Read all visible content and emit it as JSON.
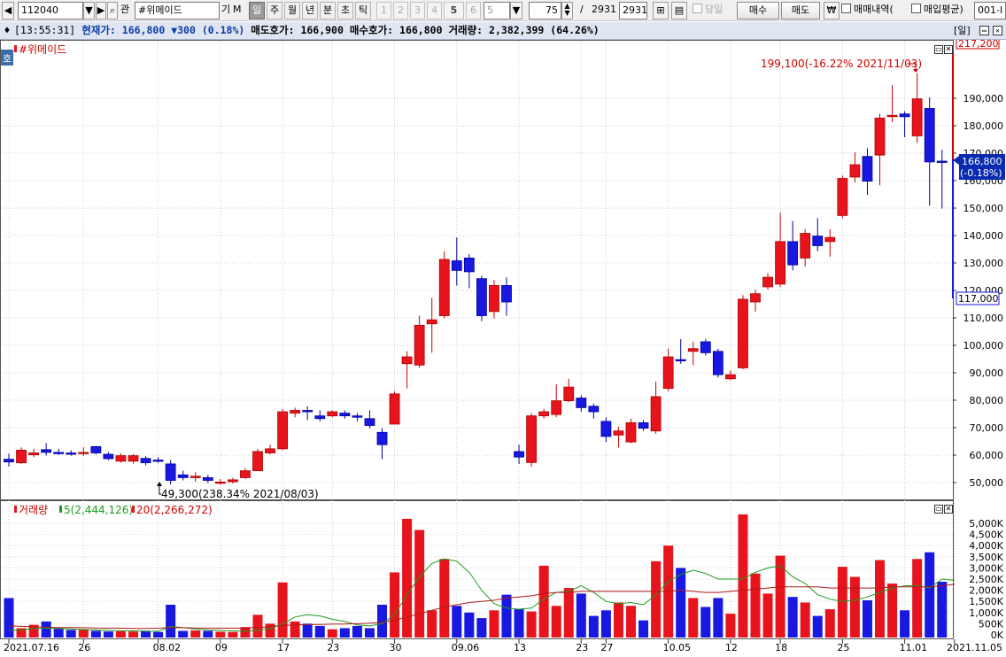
{
  "toolbar": {
    "stock_code": "112040",
    "filter_label": "관",
    "stock_name": "#위메이드",
    "gi_label": "기",
    "m_label": "M",
    "periods": [
      "일",
      "주",
      "월",
      "년",
      "분",
      "초",
      "틱"
    ],
    "active_period": "일",
    "numbers": [
      "1",
      "2",
      "3",
      "4",
      "5",
      "6"
    ],
    "strong_number": "5",
    "number_select": "5",
    "view_count": "75",
    "separator": "/",
    "total_count": "2931",
    "total_count_box": "2931",
    "same_day_label": "당일",
    "buy_label": "매수",
    "sell_label": "매도",
    "won_label": "₩",
    "trade_history_label": "매매내역(",
    "avg_price_label": "매입평균)",
    "account": "001-I"
  },
  "infobar": {
    "time": "[13:55:31]",
    "current_label": "현재가:",
    "current_value": "166,800",
    "change_text": "▼300",
    "change_pct": "(0.18%)",
    "ask_label": "매도호가:",
    "ask_value": "166,900",
    "bid_label": "매수호가:",
    "bid_value": "166,800",
    "volume_label": "거래량:",
    "volume_value": "2,382,399",
    "volume_pct": "(64.26%)",
    "period_badge": "[일]"
  },
  "price_panel": {
    "title": "#위메이드",
    "side_tab": "호",
    "high_label": "199,100(-16.22% 2021/11/03)",
    "low_label": "49,300(238.34% 2021/08/03)",
    "top_tag": "217,200",
    "current_tag_1": "166,800",
    "current_tag_2": "(-0.18%)",
    "bottom_tag": "117,000",
    "y_ticks": [
      "190,000",
      "180,000",
      "170,000",
      "160,000",
      "150,000",
      "140,000",
      "130,000",
      "120,000",
      "110,000",
      "100,000",
      "90,000",
      "80,000",
      "70,000",
      "60,000",
      "50,000"
    ]
  },
  "volume_panel": {
    "title": "거래량",
    "ma5_label": "5(2,444,126)",
    "ma20_label": "20(2,266,272)",
    "y_ticks": [
      "5,000K",
      "4,500K",
      "4,000K",
      "3,500K",
      "3,000K",
      "2,500K",
      "2,000K",
      "1,500K",
      "1,000K",
      "500K",
      "0K"
    ]
  },
  "x_labels": [
    "2021.07.16",
    "26",
    "08.02",
    "09",
    "17",
    "23",
    "30",
    "09.06",
    "13",
    "23",
    "27",
    "10.05",
    "12",
    "18",
    "25",
    "11.01",
    "2021.11.05"
  ],
  "colors": {
    "up": "#e8141d",
    "down": "#1818e0",
    "ma5": "#1c9a1c",
    "ma20": "#b01818",
    "current_tag": "#0a2bb0"
  },
  "chart_data": {
    "type": "candlestick",
    "ylim": [
      45000,
      217200
    ],
    "volume_ylim": [
      0,
      5600
    ],
    "volume_unit": "K",
    "candles": [
      {
        "o": 58500,
        "c": 57500,
        "h": 60500,
        "l": 55800,
        "v": 1650
      },
      {
        "o": 57200,
        "c": 61800,
        "h": 62800,
        "l": 56800,
        "v": 300
      },
      {
        "o": 60100,
        "c": 60800,
        "h": 62300,
        "l": 59300,
        "v": 450
      },
      {
        "o": 62000,
        "c": 61000,
        "h": 64300,
        "l": 59800,
        "v": 600
      },
      {
        "o": 61000,
        "c": 60700,
        "h": 62300,
        "l": 60100,
        "v": 300
      },
      {
        "o": 60800,
        "c": 60500,
        "h": 61800,
        "l": 59800,
        "v": 220
      },
      {
        "o": 60800,
        "c": 61000,
        "h": 62800,
        "l": 59700,
        "v": 250
      },
      {
        "o": 63100,
        "c": 60800,
        "h": 63400,
        "l": 60200,
        "v": 180
      },
      {
        "o": 60300,
        "c": 58700,
        "h": 61200,
        "l": 58200,
        "v": 150
      },
      {
        "o": 57800,
        "c": 59800,
        "h": 60700,
        "l": 57200,
        "v": 160
      },
      {
        "o": 57800,
        "c": 59800,
        "h": 60400,
        "l": 56900,
        "v": 150
      },
      {
        "o": 58800,
        "c": 57200,
        "h": 59600,
        "l": 56300,
        "v": 160
      },
      {
        "o": 58200,
        "c": 57800,
        "h": 59300,
        "l": 57200,
        "v": 130
      },
      {
        "o": 56800,
        "c": 50800,
        "h": 58200,
        "l": 49300,
        "v": 1350
      },
      {
        "o": 52800,
        "c": 51800,
        "h": 54300,
        "l": 50800,
        "v": 180
      },
      {
        "o": 51800,
        "c": 52300,
        "h": 53800,
        "l": 50300,
        "v": 200
      },
      {
        "o": 51800,
        "c": 50800,
        "h": 52800,
        "l": 49800,
        "v": 180
      },
      {
        "o": 50200,
        "c": 50200,
        "h": 51300,
        "l": 49300,
        "v": 140
      },
      {
        "o": 50300,
        "c": 51000,
        "h": 51800,
        "l": 49600,
        "v": 130
      },
      {
        "o": 51800,
        "c": 54300,
        "h": 55300,
        "l": 51300,
        "v": 350
      },
      {
        "o": 54300,
        "c": 61300,
        "h": 62300,
        "l": 54300,
        "v": 900
      },
      {
        "o": 60800,
        "c": 62300,
        "h": 63800,
        "l": 60300,
        "v": 500
      },
      {
        "o": 62300,
        "c": 75800,
        "h": 76800,
        "l": 61800,
        "v": 2350
      },
      {
        "o": 75300,
        "c": 76300,
        "h": 77300,
        "l": 73800,
        "v": 600
      },
      {
        "o": 76300,
        "c": 75800,
        "h": 77800,
        "l": 72800,
        "v": 500
      },
      {
        "o": 74300,
        "c": 73300,
        "h": 76300,
        "l": 72300,
        "v": 400
      },
      {
        "o": 74300,
        "c": 75800,
        "h": 76300,
        "l": 73800,
        "v": 250
      },
      {
        "o": 75300,
        "c": 74300,
        "h": 76300,
        "l": 73300,
        "v": 300
      },
      {
        "o": 74300,
        "c": 73800,
        "h": 75300,
        "l": 72300,
        "v": 400
      },
      {
        "o": 73300,
        "c": 70800,
        "h": 76300,
        "l": 69800,
        "v": 300
      },
      {
        "o": 68300,
        "c": 63800,
        "h": 69800,
        "l": 58500,
        "v": 1350
      },
      {
        "o": 71300,
        "c": 82300,
        "h": 83300,
        "l": 71300,
        "v": 2800
      },
      {
        "o": 93300,
        "c": 95800,
        "h": 97800,
        "l": 84300,
        "v": 5200
      },
      {
        "o": 92800,
        "c": 107300,
        "h": 110800,
        "l": 91800,
        "v": 4700
      },
      {
        "o": 107800,
        "c": 109300,
        "h": 117300,
        "l": 97300,
        "v": 1100
      },
      {
        "o": 110800,
        "c": 131300,
        "h": 134300,
        "l": 109800,
        "v": 3400
      },
      {
        "o": 130800,
        "c": 127300,
        "h": 139300,
        "l": 121800,
        "v": 1300
      },
      {
        "o": 131800,
        "c": 126800,
        "h": 133300,
        "l": 120800,
        "v": 1000
      },
      {
        "o": 124300,
        "c": 110800,
        "h": 125300,
        "l": 108800,
        "v": 750
      },
      {
        "o": 112300,
        "c": 121800,
        "h": 123800,
        "l": 109800,
        "v": 1100
      },
      {
        "o": 121800,
        "c": 115800,
        "h": 124800,
        "l": 110800,
        "v": 1800
      },
      {
        "o": 61300,
        "c": 59300,
        "h": 63800,
        "l": 56800,
        "v": 1150
      },
      {
        "o": 57300,
        "c": 74300,
        "h": 75300,
        "l": 55800,
        "v": 1050
      },
      {
        "o": 74300,
        "c": 75800,
        "h": 76800,
        "l": 73300,
        "v": 3100
      },
      {
        "o": 74800,
        "c": 79800,
        "h": 85800,
        "l": 73800,
        "v": 1300
      },
      {
        "o": 79800,
        "c": 84800,
        "h": 87800,
        "l": 79300,
        "v": 2100
      },
      {
        "o": 80800,
        "c": 77300,
        "h": 81800,
        "l": 75800,
        "v": 1850
      },
      {
        "o": 77800,
        "c": 75800,
        "h": 78800,
        "l": 73300,
        "v": 850
      },
      {
        "o": 72300,
        "c": 66800,
        "h": 73800,
        "l": 64800,
        "v": 1100
      },
      {
        "o": 67300,
        "c": 68800,
        "h": 70300,
        "l": 62800,
        "v": 1450
      },
      {
        "o": 64800,
        "c": 71800,
        "h": 73300,
        "l": 64300,
        "v": 1300
      },
      {
        "o": 71800,
        "c": 69800,
        "h": 72800,
        "l": 68800,
        "v": 650
      },
      {
        "o": 68800,
        "c": 81300,
        "h": 86800,
        "l": 67800,
        "v": 3300
      },
      {
        "o": 84300,
        "c": 95800,
        "h": 98800,
        "l": 83300,
        "v": 4000
      },
      {
        "o": 94800,
        "c": 94300,
        "h": 102300,
        "l": 93300,
        "v": 3000
      },
      {
        "o": 97800,
        "c": 98800,
        "h": 101300,
        "l": 92800,
        "v": 1650
      },
      {
        "o": 101300,
        "c": 97300,
        "h": 102300,
        "l": 96300,
        "v": 1250
      },
      {
        "o": 97800,
        "c": 89300,
        "h": 98800,
        "l": 88300,
        "v": 1650
      },
      {
        "o": 87800,
        "c": 89300,
        "h": 90800,
        "l": 87300,
        "v": 950
      },
      {
        "o": 91800,
        "c": 116800,
        "h": 118300,
        "l": 91300,
        "v": 5400
      },
      {
        "o": 115800,
        "c": 118800,
        "h": 120300,
        "l": 112300,
        "v": 2750
      },
      {
        "o": 121300,
        "c": 124800,
        "h": 126300,
        "l": 120300,
        "v": 1850
      },
      {
        "o": 122300,
        "c": 137800,
        "h": 148300,
        "l": 121300,
        "v": 3550
      },
      {
        "o": 137800,
        "c": 129300,
        "h": 145300,
        "l": 127300,
        "v": 1700
      },
      {
        "o": 131800,
        "c": 140800,
        "h": 142300,
        "l": 128800,
        "v": 1450
      },
      {
        "o": 139800,
        "c": 136300,
        "h": 146300,
        "l": 134300,
        "v": 850
      },
      {
        "o": 137800,
        "c": 139300,
        "h": 142300,
        "l": 132300,
        "v": 1150
      },
      {
        "o": 147300,
        "c": 160800,
        "h": 161800,
        "l": 146300,
        "v": 3050
      },
      {
        "o": 161300,
        "c": 165800,
        "h": 170300,
        "l": 159300,
        "v": 2600
      },
      {
        "o": 168800,
        "c": 159800,
        "h": 171800,
        "l": 154800,
        "v": 1550
      },
      {
        "o": 169300,
        "c": 182800,
        "h": 184300,
        "l": 158300,
        "v": 3350
      },
      {
        "o": 183300,
        "c": 183800,
        "h": 194800,
        "l": 181300,
        "v": 2300
      },
      {
        "o": 184300,
        "c": 183300,
        "h": 185300,
        "l": 175800,
        "v": 1100
      },
      {
        "o": 176300,
        "c": 189800,
        "h": 199100,
        "l": 173800,
        "v": 3400
      },
      {
        "o": 186300,
        "c": 166800,
        "h": 190300,
        "l": 150800,
        "v": 3700
      },
      {
        "o": 167100,
        "c": 166800,
        "h": 171300,
        "l": 149800,
        "v": 2380
      }
    ],
    "ma5_volume": [
      200,
      220,
      280,
      300,
      280,
      260,
      240,
      220,
      200,
      190,
      180,
      170,
      160,
      380,
      320,
      260,
      220,
      200,
      180,
      160,
      200,
      280,
      500,
      800,
      900,
      850,
      700,
      600,
      450,
      400,
      500,
      900,
      1800,
      2600,
      3200,
      3400,
      3300,
      2800,
      2000,
      1400,
      1200,
      1150,
      1200,
      1600,
      1900,
      1950,
      2200,
      1900,
      1500,
      1400,
      1450,
      1350,
      1800,
      2400,
      2700,
      2900,
      2750,
      2500,
      2500,
      2500,
      2800,
      3000,
      3100,
      2600,
      2300,
      1800,
      1600,
      1500,
      1550,
      1700,
      1900,
      2100,
      2200,
      2200,
      2100,
      2500,
      2444
    ],
    "ma20_volume": [
      400,
      380,
      360,
      340,
      330,
      330,
      320,
      310,
      300,
      300,
      290,
      290,
      300,
      330,
      320,
      310,
      300,
      300,
      300,
      310,
      330,
      360,
      420,
      450,
      460,
      470,
      480,
      490,
      500,
      520,
      560,
      650,
      800,
      950,
      1100,
      1250,
      1350,
      1450,
      1500,
      1550,
      1650,
      1700,
      1750,
      1850,
      1900,
      1900,
      1950,
      1950,
      1950,
      1950,
      1950,
      1950,
      1950,
      1950,
      2000,
      1950,
      1900,
      1900,
      1950,
      2000,
      2050,
      2100,
      2150,
      2150,
      2150,
      2150,
      2100,
      2100,
      2100,
      2100,
      2100,
      2150,
      2150,
      2150,
      2150,
      2200,
      2266
    ]
  }
}
